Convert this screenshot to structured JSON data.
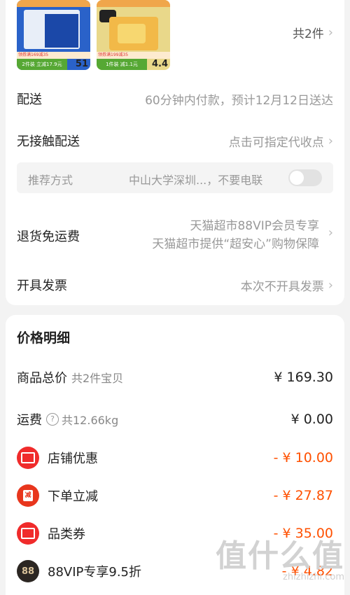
{
  "products": [
    {
      "banner": "领券满169减35",
      "deal": "2件装 立减17.9元",
      "price": "51"
    },
    {
      "banner": "领券满199减35",
      "deal": "1件装 减1.1元",
      "price": "4.4"
    }
  ],
  "items_count": "共2件",
  "delivery": {
    "label": "配送",
    "value": "60分钟内付款，预计12月12日送达"
  },
  "contactless": {
    "label": "无接触配送",
    "value": "点击可指定代收点"
  },
  "recommend": {
    "label": "推荐方式",
    "value": "中山大学深圳...，不要电联",
    "toggle_on": false
  },
  "refund": {
    "label": "退货免运费",
    "line1": "天猫超市88VIP会员专享",
    "line2": "天猫超市提供“超安心”购物保障"
  },
  "invoice": {
    "label": "开具发票",
    "value": "本次不开具发票"
  },
  "price_detail": {
    "title": "价格明细",
    "goods_total": {
      "label": "商品总价",
      "sub": "共2件宝贝",
      "amount": "¥ 169.30"
    },
    "shipping": {
      "label": "运费",
      "sub": "共12.66kg",
      "amount": "¥ 0.00"
    },
    "shop_discount": {
      "label": "店铺优惠",
      "amount": "- ¥ 10.00"
    },
    "instant_discount": {
      "label": "下单立减",
      "amount": "- ¥ 27.87",
      "icon_text": "减"
    },
    "category_coupon": {
      "label": "品类券",
      "amount": "- ¥ 35.00"
    },
    "vip": {
      "label": "88VIP专享9.5折",
      "amount": "- ¥ 4.82",
      "icon_text": "88"
    }
  },
  "watermark": {
    "big": "值什么值",
    "small": "zhizhizhi.com"
  },
  "colors": {
    "accent": "#ff5000",
    "badge_red": "#f02b2b"
  }
}
